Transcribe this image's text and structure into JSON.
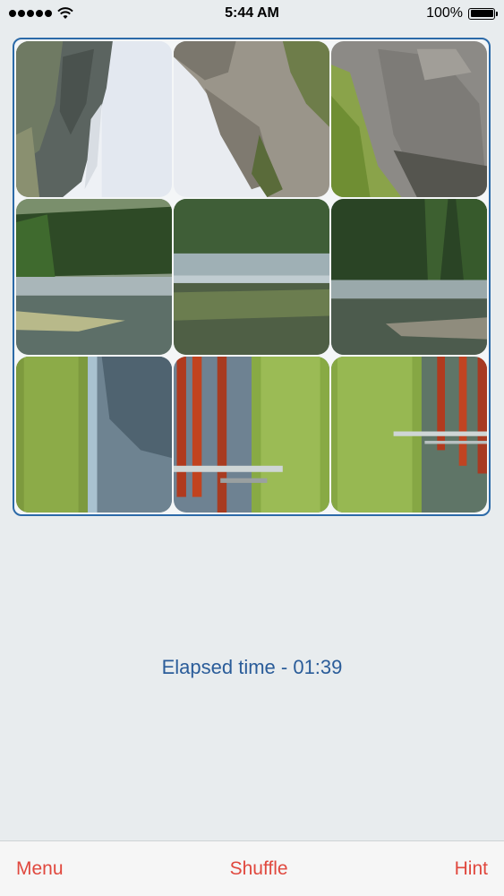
{
  "status_bar": {
    "time": "5:44 AM",
    "battery": "100%",
    "icons": [
      "signal-icon",
      "wifi-icon",
      "battery-icon"
    ]
  },
  "puzzle": {
    "grid": "3x3",
    "tiles": [
      {
        "id": 1,
        "content": "mountain-cliff"
      },
      {
        "id": 2,
        "content": "rock-face"
      },
      {
        "id": 3,
        "content": "rock-slope"
      },
      {
        "id": 4,
        "content": "forest-shore"
      },
      {
        "id": 5,
        "content": "lake-reflection"
      },
      {
        "id": 6,
        "content": "pine-forest"
      },
      {
        "id": 7,
        "content": "grass-water"
      },
      {
        "id": 8,
        "content": "dock-grass"
      },
      {
        "id": 9,
        "content": "grass-dock"
      }
    ],
    "border_color": "#2c6aa8"
  },
  "elapsed": {
    "text": "Elapsed time - 01:39"
  },
  "toolbar": {
    "menu_label": "Menu",
    "shuffle_label": "Shuffle",
    "hint_label": "Hint",
    "accent_color": "#e0483e"
  }
}
